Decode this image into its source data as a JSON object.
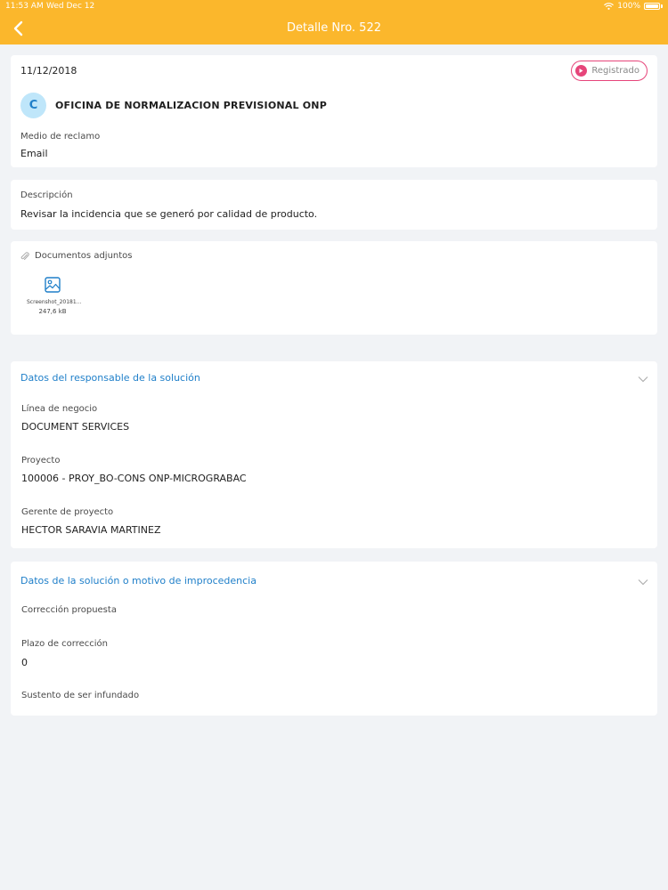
{
  "status_bar": {
    "time": "11:53 AM",
    "date": "Wed Dec 12",
    "battery": "100%"
  },
  "nav": {
    "title": "Detalle Nro. 522",
    "back_icon": "chevron-left-icon"
  },
  "header_card": {
    "date": "11/12/2018",
    "status": "Registrado",
    "avatar_letter": "C",
    "organization": "OFICINA DE NORMALIZACION PREVISIONAL ONP",
    "claim_medium_label": "Medio de reclamo",
    "claim_medium_value": "Email"
  },
  "description_card": {
    "label": "Descripción",
    "text": "Revisar la incidencia que se generó por calidad de producto."
  },
  "attachments_card": {
    "label": "Documentos adjuntos",
    "files": [
      {
        "name": "Screenshot_20181...",
        "size": "247,6 kB"
      }
    ]
  },
  "responsible_section": {
    "title": "Datos del responsable de la solución",
    "fields": [
      {
        "label": "Línea de negocio",
        "value": "DOCUMENT SERVICES"
      },
      {
        "label": "Proyecto",
        "value": "100006 - PROY_BO-CONS ONP-MICROGRABAC"
      },
      {
        "label": "Gerente de proyecto",
        "value": "HECTOR SARAVIA MARTINEZ"
      }
    ]
  },
  "solution_section": {
    "title": "Datos de la solución o motivo de improcedencia",
    "fields": [
      {
        "label": "Corrección propuesta",
        "value": ""
      },
      {
        "label": "Plazo de corrección",
        "value": "0"
      },
      {
        "label": "Sustento de ser infundado",
        "value": ""
      }
    ]
  },
  "colors": {
    "accent": "#fbb72c",
    "link": "#1f7fc9",
    "status": "#e6457a",
    "background": "#f1f3f6"
  }
}
